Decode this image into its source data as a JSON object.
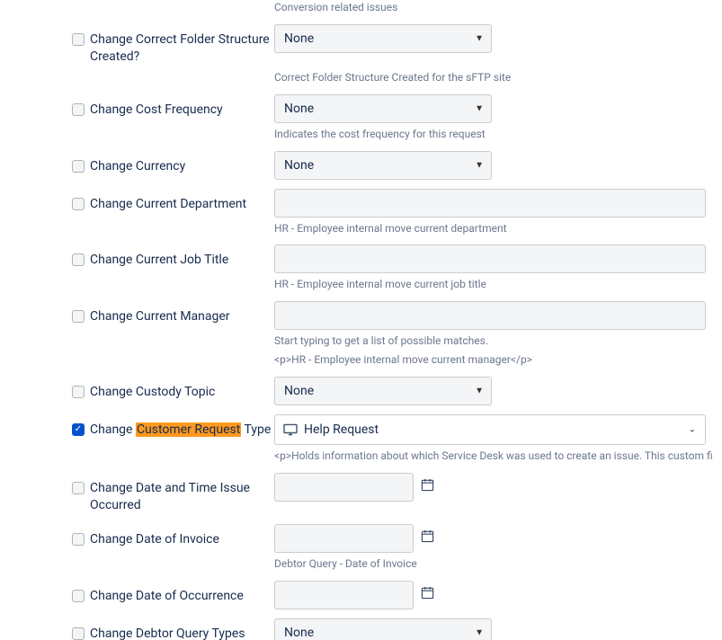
{
  "topHelp": "Conversion related issues",
  "rows": [
    {
      "label_pre": "Change Correct Folder Structure Created?",
      "select_value": "None",
      "help": "Correct Folder Structure Created for the sFTP site"
    },
    {
      "label_pre": "Change Cost Frequency",
      "select_value": "None",
      "help": "Indicates the cost frequency for this request"
    },
    {
      "label_pre": "Change Currency",
      "select_value": "None"
    },
    {
      "label_pre": "Change Current Department",
      "text": true,
      "help": "HR - Employee internal move current department"
    },
    {
      "label_pre": "Change Current Job Title",
      "text": true,
      "help": "HR - Employee internal move current job title"
    },
    {
      "label_pre": "Change Current Manager",
      "text": true,
      "help": "Start typing to get a list of possible matches.",
      "help2": "<p>HR - Employee internal move current manager</p>"
    },
    {
      "label_pre": "Change Custody Topic",
      "select_value": "None"
    },
    {
      "label_pre": "Change ",
      "label_hl": "Customer Request",
      "label_post": " Type",
      "checked": true,
      "wide_select": "Help Request",
      "help": "<p>Holds information about which Service Desk was used to create an issue. This custom field"
    },
    {
      "label_pre": "Change Date and Time Issue Occurred",
      "date": true
    },
    {
      "label_pre": "Change Date of Invoice",
      "date": true,
      "help": "Debtor Query - Date of Invoice"
    },
    {
      "label_pre": "Change Date of Occurrence",
      "date": true
    },
    {
      "label_pre": "Change Debtor Query Types",
      "select_value": "None"
    }
  ]
}
